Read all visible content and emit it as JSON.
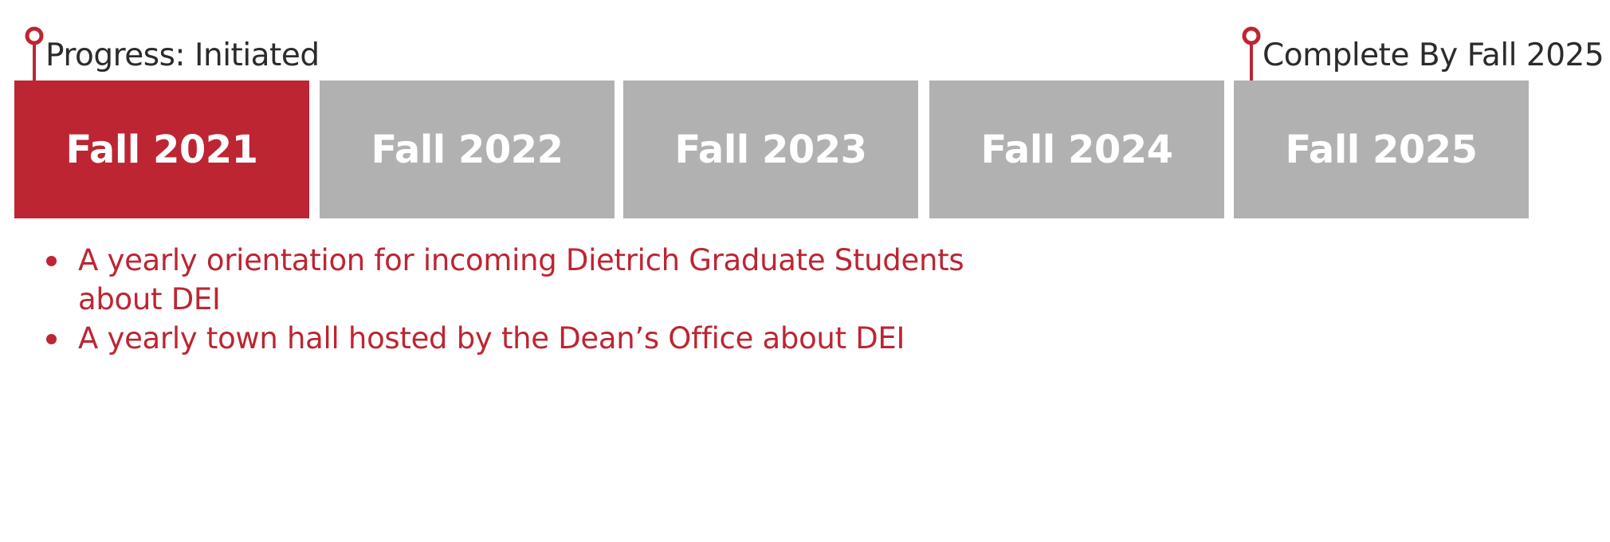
{
  "colors": {
    "accent": "#bd2532",
    "inactive": "#b1b1b1",
    "label_text": "#2b2b2b",
    "box_text": "#ffffff"
  },
  "markers": {
    "start": {
      "label": "Progress: Initiated",
      "icon": "pin-marker-icon"
    },
    "end": {
      "label": "Complete By Fall 2025",
      "icon": "pin-marker-icon"
    }
  },
  "timeline": {
    "years": [
      {
        "label": "Fall 2021",
        "active": true
      },
      {
        "label": "Fall 2022",
        "active": false
      },
      {
        "label": "Fall 2023",
        "active": false
      },
      {
        "label": "Fall 2024",
        "active": false
      },
      {
        "label": "Fall 2025",
        "active": false
      }
    ]
  },
  "goals": [
    "A yearly orientation for incoming Dietrich Graduate Students about DEI",
    "A yearly town hall hosted by the Dean’s Office about DEI"
  ]
}
